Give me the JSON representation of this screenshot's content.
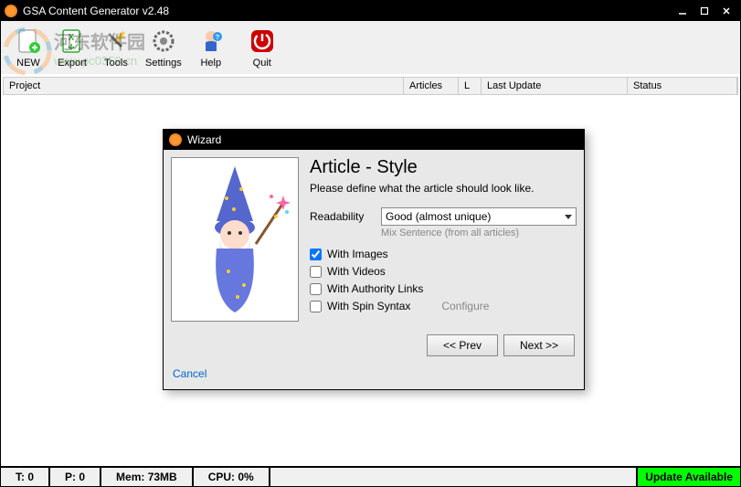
{
  "window": {
    "title": "GSA Content Generator v2.48"
  },
  "toolbar": {
    "new": "NEW",
    "export": "Export",
    "tools": "Tools",
    "settings": "Settings",
    "help": "Help",
    "quit": "Quit"
  },
  "table": {
    "project": "Project",
    "articles": "Articles",
    "l": "L",
    "lastupdate": "Last Update",
    "status": "Status"
  },
  "wizard": {
    "title": "Wizard",
    "heading": "Article - Style",
    "sub": "Please define what the article should look like.",
    "readability_label": "Readability",
    "readability_value": "Good (almost unique)",
    "readability_hint": "Mix Sentence (from all articles)",
    "with_images": "With Images",
    "with_videos": "With Videos",
    "with_authority": "With Authority Links",
    "with_spin": "With Spin Syntax",
    "configure": "Configure",
    "prev": "<< Prev",
    "next": "Next >>",
    "cancel": "Cancel",
    "checked": {
      "images": true,
      "videos": false,
      "authority": false,
      "spin": false
    }
  },
  "status": {
    "t": "T: 0",
    "p": "P: 0",
    "mem": "Mem: 73MB",
    "cpu": "CPU: 0%",
    "update": "Update Available"
  },
  "watermark": {
    "line1": "河东软件园",
    "line2": "www.pc0359.cn"
  }
}
